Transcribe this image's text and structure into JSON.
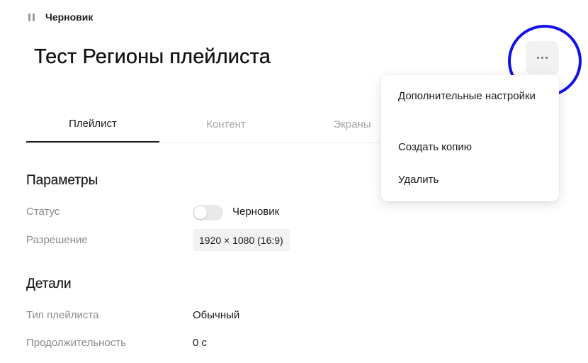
{
  "status_indicator": {
    "icon": "pause-icon",
    "label": "Черновик"
  },
  "page": {
    "title": "Тест Регионы плейлиста"
  },
  "more_button": {
    "icon": "more-horizontal-icon"
  },
  "tabs": [
    {
      "label": "Плейлист",
      "active": true
    },
    {
      "label": "Контент",
      "active": false
    },
    {
      "label": "Экраны",
      "active": false
    }
  ],
  "dropdown": {
    "items": [
      {
        "label": "Дополнительные настройки"
      },
      {
        "label": "Создать копию"
      },
      {
        "label": "Удалить"
      }
    ]
  },
  "parameters": {
    "title": "Параметры",
    "status_label": "Статус",
    "status_value": "Черновик",
    "status_toggle_on": false,
    "resolution_label": "Разрешение",
    "resolution_value": "1920 × 1080 (16:9)"
  },
  "details": {
    "title": "Детали",
    "type_label": "Тип плейлиста",
    "type_value": "Обычный",
    "duration_label": "Продолжительность",
    "duration_value": "0 с"
  },
  "colors": {
    "highlight": "#1010e8",
    "active_tab": "#1a1a1a",
    "inactive_tab": "#a6a6a6"
  }
}
